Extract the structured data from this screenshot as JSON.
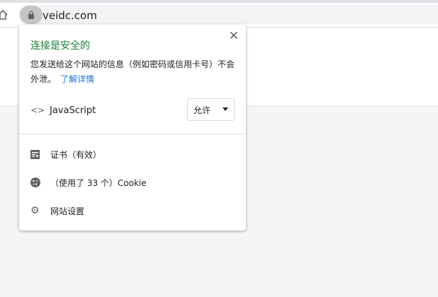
{
  "browser": {
    "url": "veidc.com"
  },
  "popup": {
    "title": "连接是安全的",
    "description": "您发送给这个网站的信息（例如密码或信用卡号）不会外泄。",
    "learn_more": "了解详情",
    "javascript": {
      "label": "JavaScript",
      "setting": "允许"
    },
    "items": [
      {
        "icon": "certificate-icon",
        "label": "证书（有效）"
      },
      {
        "icon": "cookie-icon",
        "label": "（使用了 33 个）Cookie"
      },
      {
        "icon": "gear-icon",
        "label": "网站设置"
      }
    ]
  },
  "colors": {
    "secure_green": "#188038",
    "link_blue": "#1a73e8"
  }
}
